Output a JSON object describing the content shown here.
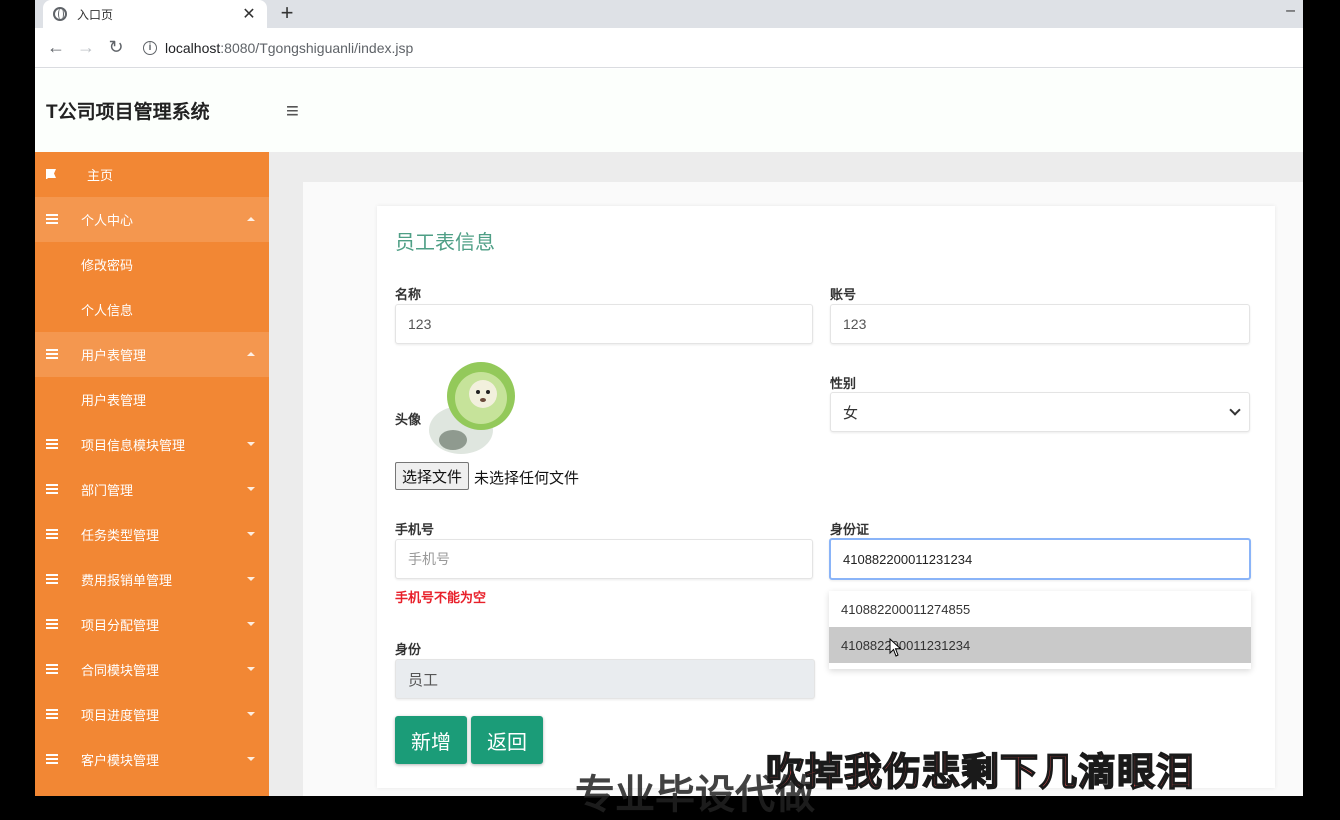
{
  "browser": {
    "tab_title": "入口页",
    "tab_close": "✕",
    "new_tab": "+",
    "window_minimize": "–",
    "back": "←",
    "forward": "→",
    "reload": "↻",
    "url_host": "localhost",
    "url_path": ":8080/Tgongshiguanli/index.jsp"
  },
  "header": {
    "brand": "T公司项目管理系统",
    "menu_toggle": "≡"
  },
  "sidebar": {
    "items": [
      {
        "label": "主页",
        "icon": "flag-icon",
        "type": "home"
      },
      {
        "label": "个人中心",
        "icon": "grid-icon",
        "type": "parent-open"
      },
      {
        "label": "修改密码",
        "type": "sub"
      },
      {
        "label": "个人信息",
        "type": "sub"
      },
      {
        "label": "用户表管理",
        "icon": "grid-icon",
        "type": "parent-open"
      },
      {
        "label": "用户表管理",
        "type": "sub"
      },
      {
        "label": "项目信息模块管理",
        "icon": "grid-icon",
        "type": "parent"
      },
      {
        "label": "部门管理",
        "icon": "grid-icon",
        "type": "parent"
      },
      {
        "label": "任务类型管理",
        "icon": "grid-icon",
        "type": "parent"
      },
      {
        "label": "费用报销单管理",
        "icon": "grid-icon",
        "type": "parent"
      },
      {
        "label": "项目分配管理",
        "icon": "grid-icon",
        "type": "parent"
      },
      {
        "label": "合同模块管理",
        "icon": "grid-icon",
        "type": "parent"
      },
      {
        "label": "项目进度管理",
        "icon": "grid-icon",
        "type": "parent"
      },
      {
        "label": "客户模块管理",
        "icon": "grid-icon",
        "type": "parent"
      }
    ]
  },
  "form": {
    "title": "员工表信息",
    "name_label": "名称",
    "name_value": "123",
    "account_label": "账号",
    "account_value": "123",
    "avatar_label": "头像",
    "gender_label": "性别",
    "gender_value": "女",
    "file_button": "选择文件",
    "file_status": "未选择任何文件",
    "phone_label": "手机号",
    "phone_placeholder": "手机号",
    "phone_error": "手机号不能为空",
    "idcard_label": "身份证",
    "idcard_value": "410882200011231234",
    "idcard_suggestions": [
      "410882200011274855",
      "410882200011231234"
    ],
    "role_label": "身份",
    "role_value": "员工",
    "add_button": "新增",
    "back_button": "返回"
  },
  "overlay": {
    "subtitle": "吹掉我伤悲剩下几滴眼泪",
    "subtitle_partial": "专业毕设代做"
  }
}
